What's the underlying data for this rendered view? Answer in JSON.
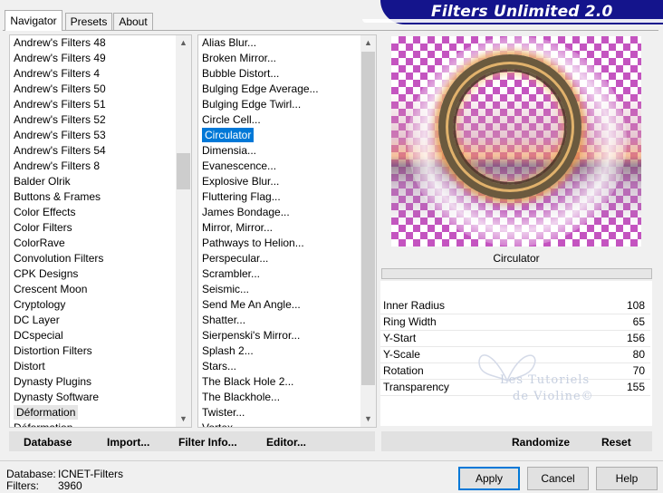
{
  "tabs": [
    {
      "label": "Navigator",
      "active": true
    },
    {
      "label": "Presets",
      "active": false
    },
    {
      "label": "About",
      "active": false
    }
  ],
  "banner_title": "Filters Unlimited 2.0",
  "categories": [
    "Andrew's Filters 48",
    "Andrew's Filters 49",
    "Andrew's Filters 4",
    "Andrew's Filters 50",
    "Andrew's Filters 51",
    "Andrew's Filters 52",
    "Andrew's Filters 53",
    "Andrew's Filters 54",
    "Andrew's Filters 8",
    "Balder Olrik",
    "Buttons & Frames",
    "Color Effects",
    "Color Filters",
    "ColorRave",
    "Convolution Filters",
    "CPK Designs",
    "Crescent Moon",
    "Cryptology",
    "DC Layer",
    "DCspecial",
    "Distortion Filters",
    "Distort",
    "Dynasty Plugins",
    "Dynasty Software",
    "Déformation",
    "Déformation"
  ],
  "categories_selected": "Déformation",
  "filters": [
    "Alias Blur...",
    "Broken Mirror...",
    "Bubble Distort...",
    "Bulging Edge Average...",
    "Bulging Edge Twirl...",
    "Circle Cell...",
    "Circulator",
    "Dimensia...",
    "Evanescence...",
    "Explosive Blur...",
    "Fluttering Flag...",
    "James Bondage...",
    "Mirror, Mirror...",
    "Pathways to Helion...",
    "Perspecular...",
    "Scrambler...",
    "Seismic...",
    "Send Me An Angle...",
    "Shatter...",
    "Sierpenski's Mirror...",
    "Splash 2...",
    "Stars...",
    "The Black Hole 2...",
    "The Blackhole...",
    "Twister...",
    "Vortex..."
  ],
  "filters_selected": "Circulator",
  "preview": {
    "filter_name": "Circulator"
  },
  "params": [
    {
      "label": "Inner Radius",
      "value": "108"
    },
    {
      "label": "Ring Width",
      "value": "65"
    },
    {
      "label": "Y-Start",
      "value": "156"
    },
    {
      "label": "Y-Scale",
      "value": "80"
    },
    {
      "label": "Rotation",
      "value": "70"
    },
    {
      "label": "Transparency",
      "value": "155"
    }
  ],
  "watermark": {
    "line1": "Les Tutoriels",
    "line2": "de Violine©"
  },
  "toolbar": {
    "database": "Database",
    "import": "Import...",
    "filter_info": "Filter Info...",
    "editor": "Editor...",
    "randomize": "Randomize",
    "reset": "Reset"
  },
  "status": {
    "database_label": "Database:",
    "database_value": "ICNET-Filters",
    "filters_label": "Filters:",
    "filters_value": "3960"
  },
  "dialog_buttons": {
    "apply": "Apply",
    "cancel": "Cancel",
    "help": "Help"
  },
  "colors": {
    "banner": "#14148c",
    "selection": "#0078d7",
    "checker": "#c454c0"
  }
}
